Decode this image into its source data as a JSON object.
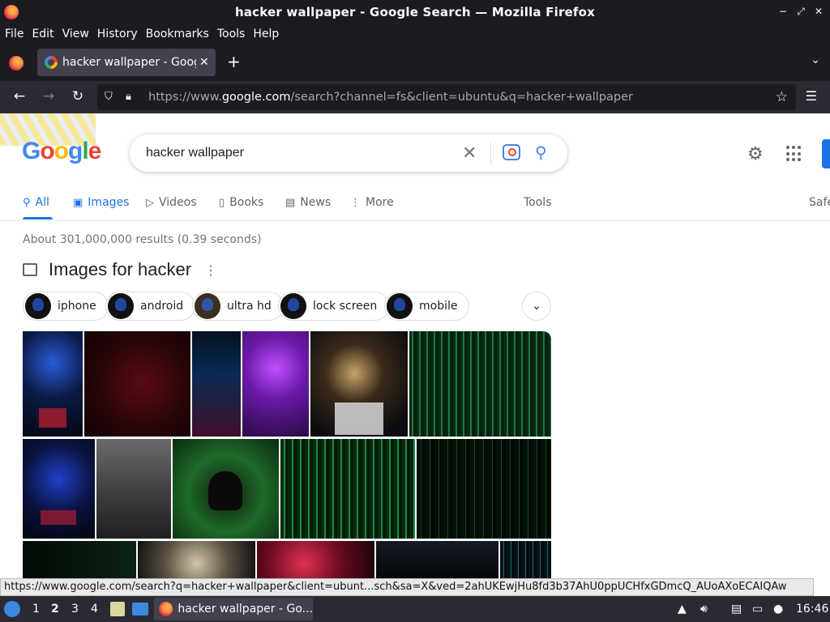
{
  "window": {
    "title": "hacker wallpaper - Google Search — Mozilla Firefox",
    "controls": [
      "−",
      "⤢",
      "✕"
    ]
  },
  "menu": [
    "File",
    "Edit",
    "View",
    "History",
    "Bookmarks",
    "Tools",
    "Help"
  ],
  "tab": {
    "label": "hacker wallpaper - Google Search",
    "close": "✕",
    "new_tab": "+",
    "list": "⌄"
  },
  "nav": {
    "url_prefix": "https://www.",
    "url_domain": "google.com",
    "url_rest": "/search?channel=fs&client=ubuntu&q=hacker+wallpaper"
  },
  "google": {
    "logo": [
      "G",
      "o",
      "o",
      "g",
      "l",
      "e"
    ],
    "query": "hacker wallpaper",
    "tabs": {
      "all": "All",
      "images": "Images",
      "videos": "Videos",
      "books": "Books",
      "news": "News",
      "more": "More",
      "tools": "Tools",
      "safe": "Safe"
    },
    "stats": "About 301,000,000 results (0.39 seconds)",
    "images_heading": "Images for hacker",
    "chips": [
      "iphone",
      "android",
      "ultra hd",
      "lock screen",
      "mobile"
    ]
  },
  "status_link": "https://www.google.com/search?q=hacker+wallpaper&client=ubunt...sch&sa=X&ved=2ahUKEwjHu8fd3b37AhU0ppUCHfxGDmcQ_AUoAXoECAIQAw",
  "taskbar": {
    "workspaces": [
      "1",
      "2",
      "3",
      "4"
    ],
    "task_label": "hacker wallpaper - Go...",
    "clock": "16:46"
  },
  "colors": {
    "accent": "#1a73e8",
    "chrome_dark": "#1c1b22"
  }
}
